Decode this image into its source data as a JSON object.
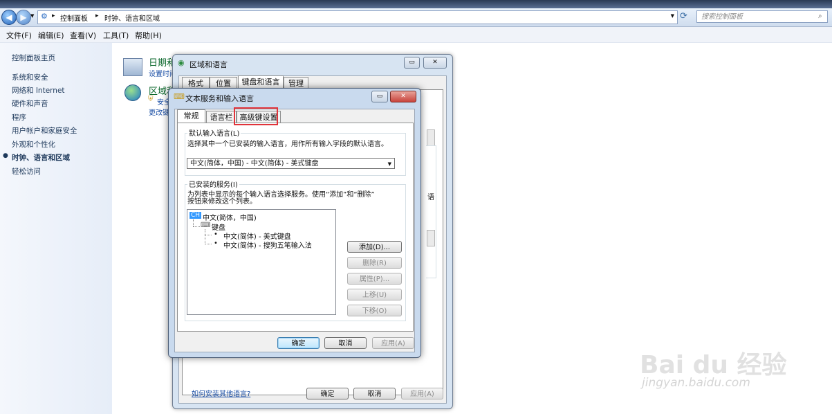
{
  "address_bar": {
    "path": [
      "控制面板",
      "时钟、语言和区域"
    ],
    "search_placeholder": "搜索控制面板"
  },
  "menu": [
    "文件(F)",
    "编辑(E)",
    "查看(V)",
    "工具(T)",
    "帮助(H)"
  ],
  "sidebar": {
    "items": [
      "控制面板主页",
      "系统和安全",
      "网络和 Internet",
      "硬件和声音",
      "程序",
      "用户帐户和家庭安全",
      "外观和个性化",
      "时钟、语言和区域",
      "轻松访问"
    ],
    "active_index": 7
  },
  "main": {
    "datetime": {
      "title": "日期和",
      "sub": "设置时间"
    },
    "region": {
      "title": "区域和",
      "sub1": "安全",
      "sub2": "更改键"
    }
  },
  "region_window": {
    "title": "区域和语言",
    "tabs": [
      "格式",
      "位置",
      "键盘和语言",
      "管理"
    ],
    "active_tab": 2,
    "right_snippet": "语",
    "link": "如何安装其他语言?",
    "buttons": {
      "ok": "确定",
      "cancel": "取消",
      "apply": "应用(A)"
    }
  },
  "text_services": {
    "title": "文本服务和输入语言",
    "tabs": [
      "常规",
      "语言栏",
      "高级键设置"
    ],
    "active_tab": 0,
    "default_group": {
      "legend": "默认输入语言(L)",
      "desc": "选择其中一个已安装的输入语言，用作所有输入字段的默认语言。",
      "selected": "中文(简体，中国) - 中文(简体) - 美式键盘"
    },
    "installed_group": {
      "legend": "已安装的服务(I)",
      "desc1": "为列表中显示的每个输入语言选择服务。使用“添加”和“删除”",
      "desc2": "按钮来修改这个列表。",
      "tree": {
        "lang_badge": "CH",
        "lang": "中文(简体，中国)",
        "keyboard": "键盘",
        "items": [
          "中文(简体) - 美式键盘",
          "中文(简体) - 搜狗五笔输入法"
        ]
      },
      "buttons": {
        "add": "添加(D)...",
        "remove": "删除(R)",
        "properties": "属性(P)...",
        "up": "上移(U)",
        "down": "下移(O)"
      }
    },
    "buttons": {
      "ok": "确定",
      "cancel": "取消",
      "apply": "应用(A)"
    }
  },
  "watermark": {
    "logo": "Bai du 经验",
    "url": "jingyan.baidu.com"
  },
  "colors": {
    "highlight_box": "#e1333a",
    "close_button": "#c9443d",
    "link": "#1b4fa5"
  }
}
